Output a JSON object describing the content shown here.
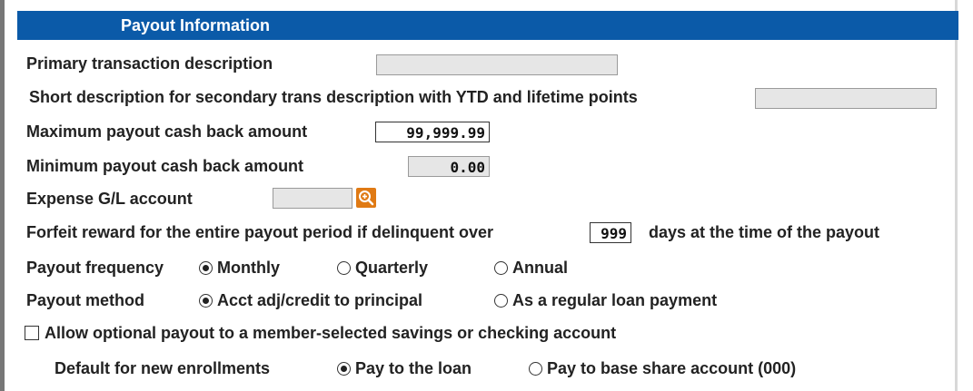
{
  "header": {
    "title": "Payout Information"
  },
  "rows": {
    "primary_desc": {
      "label": "Primary transaction description",
      "value": ""
    },
    "short_desc": {
      "label": "Short description for secondary trans description with YTD and lifetime points",
      "value": ""
    },
    "max_payout": {
      "label": "Maximum payout cash back amount",
      "value": "99,999.99"
    },
    "min_payout": {
      "label": "Minimum payout cash back amount",
      "value": "0.00"
    },
    "expense_gl": {
      "label": "Expense G/L account",
      "value": ""
    },
    "forfeit": {
      "label_before": "Forfeit reward for the entire payout period if delinquent over",
      "value": "999",
      "label_after": "days at the time of the payout"
    }
  },
  "payout_frequency": {
    "label": "Payout frequency",
    "options": [
      "Monthly",
      "Quarterly",
      "Annual"
    ],
    "selected": "Monthly"
  },
  "payout_method": {
    "label": "Payout method",
    "options": [
      "Acct adj/credit to principal",
      "As a regular loan payment"
    ],
    "selected": "Acct adj/credit to principal"
  },
  "optional_payout": {
    "label": "Allow optional payout to a member-selected savings or checking account",
    "checked": false
  },
  "default_enrollments": {
    "label": "Default for new enrollments",
    "options": [
      "Pay to the loan",
      "Pay to base share account (000)"
    ],
    "selected": "Pay to the loan"
  },
  "colors": {
    "header_bg": "#0b5aa8",
    "lookup_icon": "#e07a14"
  }
}
